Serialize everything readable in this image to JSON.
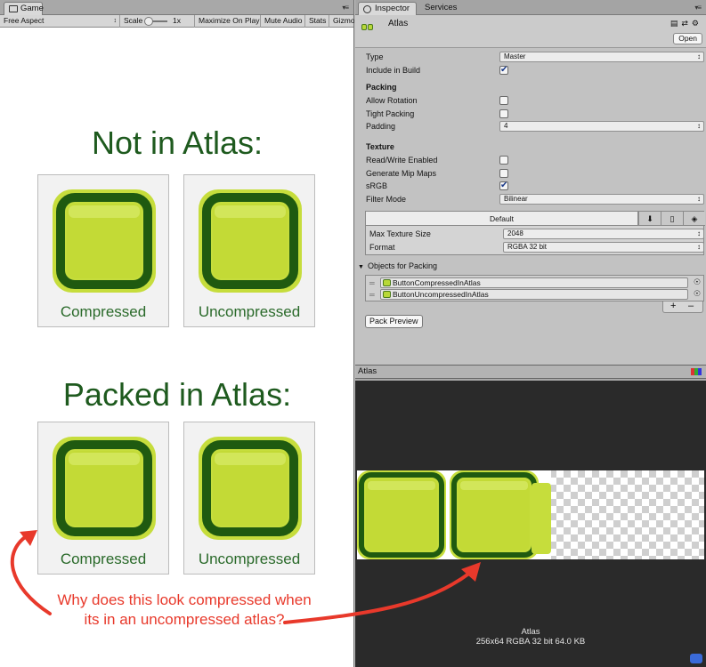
{
  "game": {
    "tab_label": "Game",
    "aspect": "Free Aspect",
    "scale_label": "Scale",
    "scale_value": "1x",
    "maximize_label": "Maximize On Play",
    "mute_label": "Mute Audio",
    "stats_label": "Stats",
    "gizmos_label": "Gizmo",
    "section1_title": "Not in Atlas:",
    "section2_title": "Packed in Atlas:",
    "compressed_label": "Compressed",
    "uncompressed_label": "Uncompressed",
    "annotation": "Why does this look compressed when its in an uncompressed atlas?",
    "annotation_color": "#e8392b",
    "title_color": "#1e5a1e"
  },
  "inspector": {
    "tab_inspector": "Inspector",
    "tab_services": "Services",
    "asset_name": "Atlas",
    "open_label": "Open",
    "type_label": "Type",
    "type_value": "Master",
    "include_label": "Include in Build",
    "include_checked": true,
    "packing_header": "Packing",
    "allow_rotation_label": "Allow Rotation",
    "tight_packing_label": "Tight Packing",
    "padding_label": "Padding",
    "padding_value": "4",
    "texture_header": "Texture",
    "readwrite_label": "Read/Write Enabled",
    "mipmaps_label": "Generate Mip Maps",
    "srgb_label": "sRGB",
    "srgb_checked": true,
    "filter_label": "Filter Mode",
    "filter_value": "Bilinear",
    "platform_default": "Default",
    "max_size_label": "Max Texture Size",
    "max_size_value": "2048",
    "format_label": "Format",
    "format_value": "RGBA 32 bit",
    "objects_label": "Objects for Packing",
    "objects": [
      "ButtonCompressedInAtlas",
      "ButtonUncompressedInAtlas"
    ],
    "pack_preview_label": "Pack Preview"
  },
  "preview": {
    "title": "Atlas",
    "info_name": "Atlas",
    "info_details": "256x64 RGBA 32 bit   64.0 KB"
  }
}
